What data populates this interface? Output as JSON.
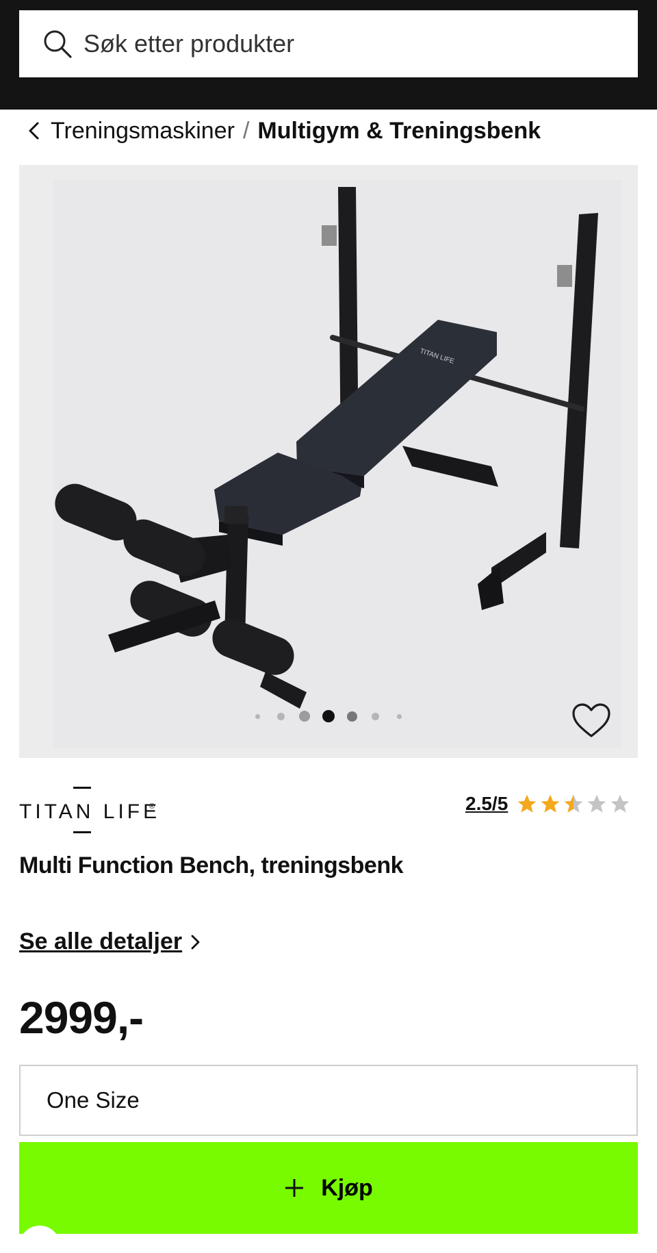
{
  "search": {
    "placeholder": "Søk etter produkter"
  },
  "breadcrumb": {
    "parent": "Treningsmaskiner",
    "separator": "/",
    "current": "Multigym & Treningsbenk"
  },
  "gallery": {
    "slide_count": 7,
    "active_slide": 4,
    "image_text": "TITAN LIFE"
  },
  "product": {
    "brand": "TITAN LIFE",
    "title": "Multi Function Bench, treningsbenk",
    "rating_text": "2.5/5",
    "rating_value": 2.5,
    "rating_max": 5,
    "details_link": "Se alle detaljer",
    "price": "2999,-"
  },
  "size": {
    "selected": "One Size"
  },
  "buy": {
    "label": "Kjøp"
  },
  "colors": {
    "topbar": "#141414",
    "buy_button": "#78fa00",
    "star_filled": "#f4a81d",
    "star_empty": "#c4c4c4",
    "gallery_bg": "#ececed"
  },
  "icons": {
    "search": "search-icon",
    "back": "chevron-left-icon",
    "favorite": "heart-icon",
    "star": "star-icon",
    "details": "chevron-right-icon",
    "buy": "plus-icon"
  }
}
